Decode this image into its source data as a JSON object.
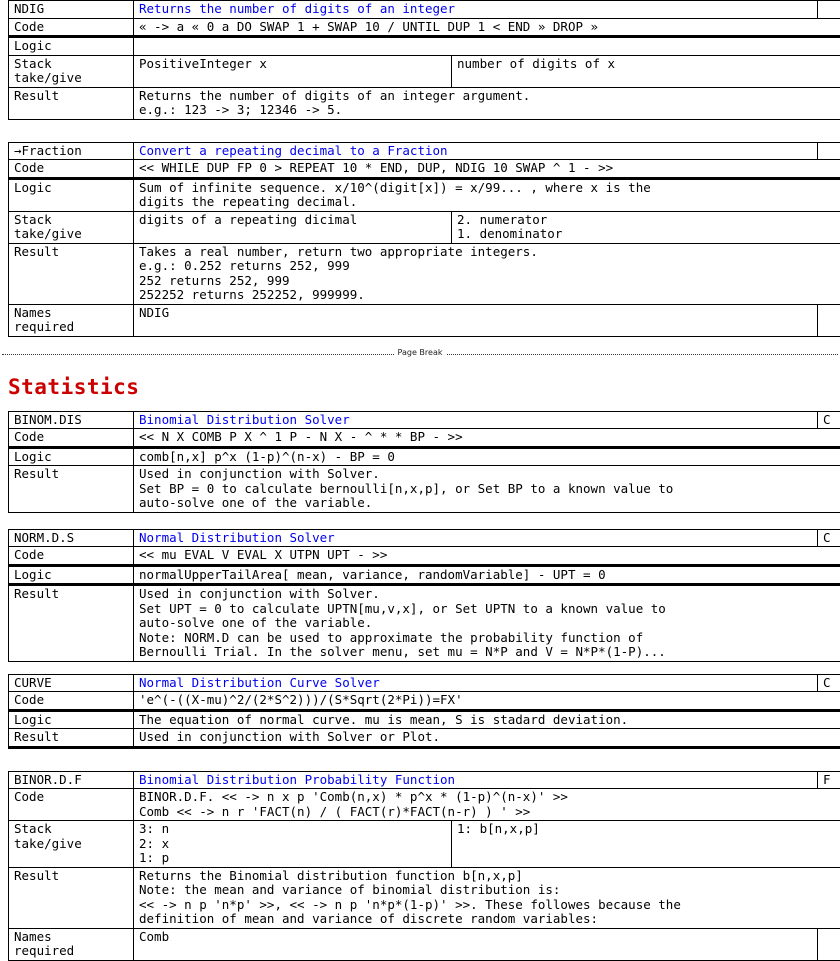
{
  "document": {
    "page_break_label": "Page Break",
    "section_heading": "Statistics",
    "accent_heading_color": "#cc0000",
    "title_text_color": "#0000ee"
  },
  "tables": [
    {
      "id": "ndig",
      "name": "NDIG",
      "title": "Returns the number of digits of an integer",
      "flag": "",
      "rows": [
        {
          "label": "Code",
          "value": "« -> a « 0 a DO SWAP 1 + SWAP 10 / UNTIL DUP 1 < END » DROP »"
        },
        {
          "label": "Logic",
          "value": ""
        }
      ],
      "stack": {
        "label": "Stack\ntake/give",
        "take": "PositiveInteger x",
        "give": "number of digits of x"
      },
      "result": {
        "label": "Result",
        "value": "Returns the number of digits of an integer argument.\ne.g.: 123 -> 3; 12346 -> 5."
      }
    },
    {
      "id": "to-fraction",
      "name": "→Fraction",
      "title": "Convert a repeating decimal to a Fraction",
      "flag": "",
      "rows": [
        {
          "label": "Code",
          "value": "<< WHILE DUP FP 0 > REPEAT 10 * END, DUP, NDIG 10 SWAP ^ 1 - >>"
        },
        {
          "label": "Logic",
          "value": "Sum of infinite sequence. x/10^(digit[x]) = x/99... , where x is the\ndigits the repeating decimal."
        }
      ],
      "stack": {
        "label": "Stack\ntake/give",
        "take": "digits of a repeating dicimal",
        "give": "2. numerator\n1. denominator"
      },
      "result": {
        "label": "Result",
        "value": "Takes a real number, return two appropriate integers.\ne.g.: 0.252 returns 252, 999\n252 returns 252, 999\n252252 returns 252252, 999999."
      },
      "names_required": {
        "label": "Names\nrequired",
        "value": "NDIG"
      }
    },
    {
      "id": "binom-dis",
      "name": "BINOM.DIS",
      "title": "Binomial Distribution Solver",
      "flag": "C",
      "rows": [
        {
          "label": "Code",
          "value": "<< N X COMB P X ^ 1 P - N X - ^ * * BP - >>"
        },
        {
          "label": "Logic",
          "value": "comb[n,x] p^x (1-p)^(n-x) - BP = 0"
        }
      ],
      "result": {
        "label": "Result",
        "value": "Used in conjunction with Solver.\nSet BP = 0 to calculate bernoulli[n,x,p], or Set BP to a known value to\nauto-solve one of the variable."
      }
    },
    {
      "id": "norm-d-s",
      "name": "NORM.D.S",
      "title": "Normal Distribution Solver",
      "flag": "C",
      "rows": [
        {
          "label": "Code",
          "value": "<< mu EVAL V EVAL X UTPN UPT - >>"
        },
        {
          "label": "Logic",
          "value": "normalUpperTailArea[ mean, variance, randomVariable] - UPT = 0"
        }
      ],
      "result": {
        "label": "Result",
        "value": "Used in conjunction with Solver.\nSet UPT = 0 to calculate UPTN[mu,v,x], or Set UPTN to a known value to\nauto-solve one of the variable.\nNote: NORM.D can be used to approximate the probability function of\nBernoulli Trial. In the solver menu, set mu = N*P and V = N*P*(1-P)..."
      }
    },
    {
      "id": "curve",
      "name": "CURVE",
      "title": "Normal Distribution Curve Solver",
      "flag": "C",
      "rows": [
        {
          "label": "Code",
          "value": "'e^(-((X-mu)^2/(2*S^2)))/(S*Sqrt(2*Pi))=FX'"
        },
        {
          "label": "Logic",
          "value": "The equation of normal curve. mu is mean, S is stadard deviation."
        }
      ],
      "result": {
        "label": "Result",
        "value": "Used in conjunction with Solver or Plot."
      }
    },
    {
      "id": "binor-d-f",
      "name": "BINOR.D.F",
      "title": "Binomial Distribution Probability Function",
      "flag": "F",
      "rows": [
        {
          "label": "Code",
          "value": "BINOR.D.F. << -> n x p 'Comb(n,x) * p^x * (1-p)^(n-x)' >>\nComb << -> n r 'FACT(n) / ( FACT(r)*FACT(n-r) ) ' >>"
        }
      ],
      "stack": {
        "label": "Stack\ntake/give",
        "take": "3: n\n2: x\n1: p",
        "give": "1: b[n,x,p]"
      },
      "result": {
        "label": "Result",
        "value": "Returns the Binomial distribution function b[n,x,p]\nNote: the mean and variance of binomial distribution is:\n<< -> n p 'n*p' >>, << -> n p 'n*p*(1-p)' >>. These followes because the\ndefinition of mean and variance of discrete random variables:"
      },
      "names_required": {
        "label": "Names\nrequired",
        "value": "Comb"
      }
    }
  ]
}
